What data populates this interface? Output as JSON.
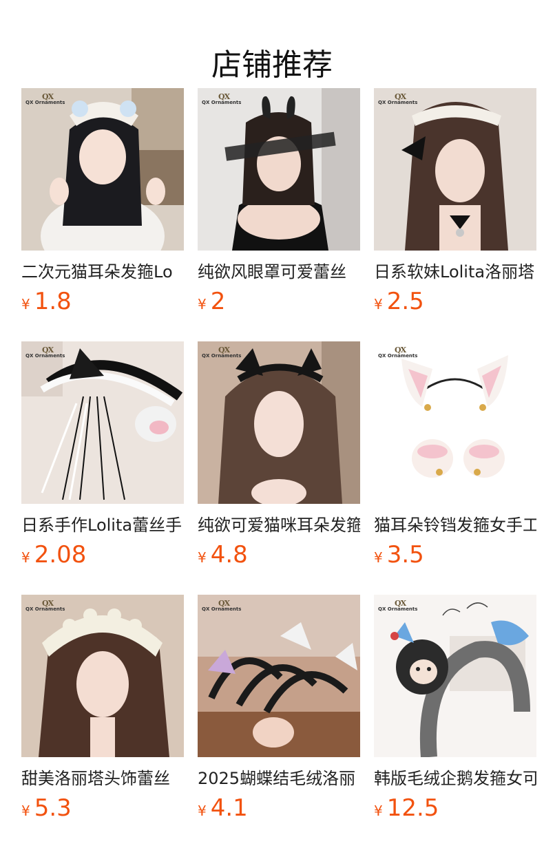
{
  "page_title": "店铺推荐",
  "currency_symbol": "¥",
  "watermark": {
    "logo": "QX",
    "text": "QX Ornaments"
  },
  "products": [
    {
      "title": "二次元猫耳朵发箍Lo",
      "price": "1.8"
    },
    {
      "title": "纯欲风眼罩可爱蕾丝",
      "price": "2"
    },
    {
      "title": "日系软妹Lolita洛丽塔",
      "price": "2.5"
    },
    {
      "title": "日系手作Lolita蕾丝手",
      "price": "2.08"
    },
    {
      "title": "纯欲可爱猫咪耳朵发箍",
      "price": "4.8"
    },
    {
      "title": "猫耳朵铃铛发箍女手工",
      "price": "3.5"
    },
    {
      "title": "甜美洛丽塔头饰蕾丝",
      "price": "5.3"
    },
    {
      "title": "2025蝴蝶结毛绒洛丽",
      "price": "4.1"
    },
    {
      "title": "韩版毛绒企鹅发箍女可",
      "price": "12.5"
    }
  ]
}
